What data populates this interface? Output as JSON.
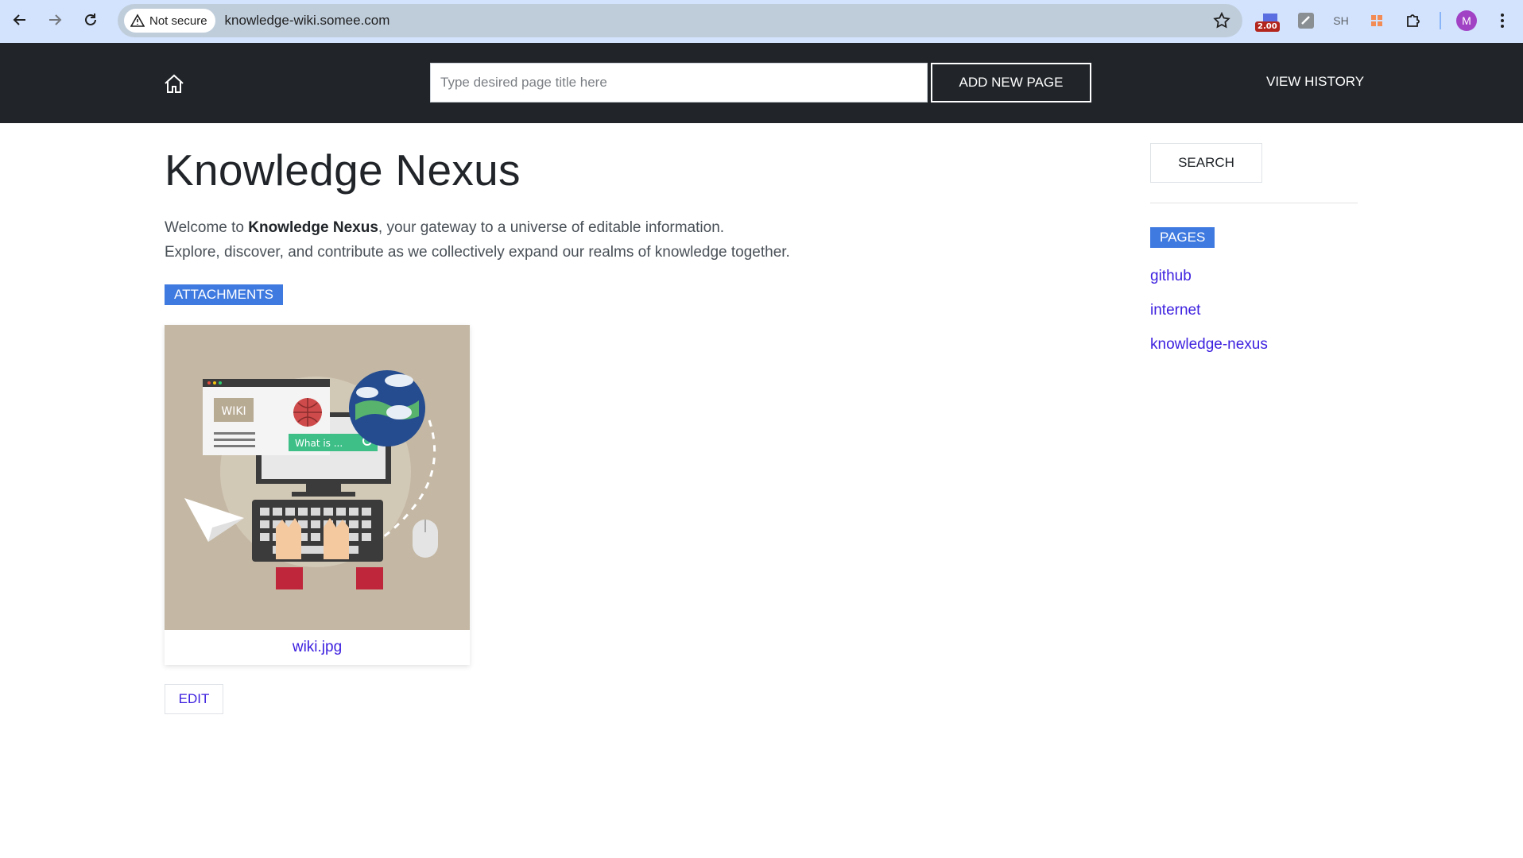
{
  "browser": {
    "security_label": "Not secure",
    "url": "knowledge-wiki.somee.com",
    "extension_badge": "2.00",
    "extension_sh": "SH",
    "profile_initial": "M"
  },
  "header": {
    "title_placeholder": "Type desired page title here",
    "add_button_label": "ADD NEW PAGE",
    "history_label": "VIEW HISTORY"
  },
  "main": {
    "title": "Knowledge Nexus",
    "intro_prefix": "Welcome to ",
    "intro_bold": "Knowledge Nexus",
    "intro_suffix": ", your gateway to a universe of editable information.",
    "intro_line2": "Explore, discover, and contribute as we collectively expand our realms of knowledge together.",
    "attachments_label": "ATTACHMENTS",
    "attachment": {
      "filename": "wiki.jpg",
      "image_text_wiki": "WIKI",
      "image_text_search": "What is ..."
    },
    "edit_label": "EDIT"
  },
  "sidebar": {
    "search_label": "SEARCH",
    "pages_label": "PAGES",
    "pages": [
      "github",
      "internet",
      "knowledge-nexus"
    ]
  },
  "colors": {
    "header_bg": "#212529",
    "badge_bg": "#3f7ae0",
    "link": "#3b1fdf"
  }
}
